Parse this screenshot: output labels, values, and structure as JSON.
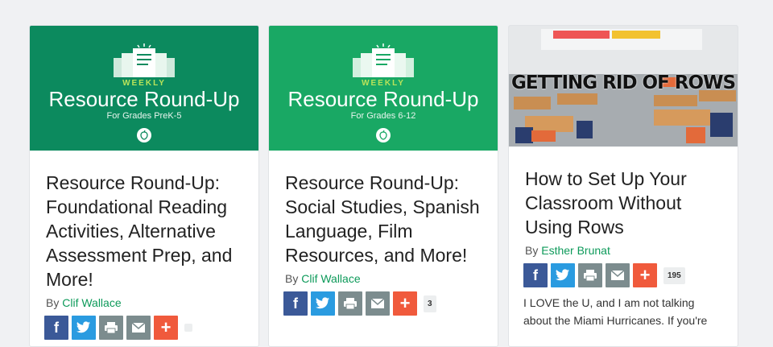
{
  "cards": [
    {
      "banner": {
        "weekly": "WEEKLY",
        "title": "Resource Round-Up",
        "grades": "For Grades PreK-5"
      },
      "title": "Resource Round-Up: Foundational Reading Activities, Alternative Assessment Prep, and More!",
      "by": "By",
      "author": "Clif Wallace",
      "share_count": ""
    },
    {
      "banner": {
        "weekly": "WEEKLY",
        "title": "Resource Round-Up",
        "grades": "For Grades 6-12"
      },
      "title": "Resource Round-Up: Social Studies, Spanish Language, Film Resources, and More!",
      "by": "By",
      "author": "Clif Wallace",
      "share_count": "3"
    },
    {
      "image_text": "GETTING RID OF ROWS",
      "title": "How to Set Up Your Classroom Without Using Rows",
      "by": "By",
      "author": "Esther Brunat",
      "share_count": "195",
      "excerpt": "I LOVE the U, and I am not talking about the Miami Hurricanes. If you're"
    }
  ],
  "icons": [
    "facebook-icon",
    "twitter-icon",
    "print-icon",
    "email-icon",
    "plus-icon"
  ],
  "colors": {
    "banner_dark": "#0c8a5e",
    "banner_light": "#19a864",
    "author_link": "#0d9a5a",
    "facebook": "#3b5998",
    "twitter": "#2a9be0",
    "plus": "#f05a3c"
  }
}
